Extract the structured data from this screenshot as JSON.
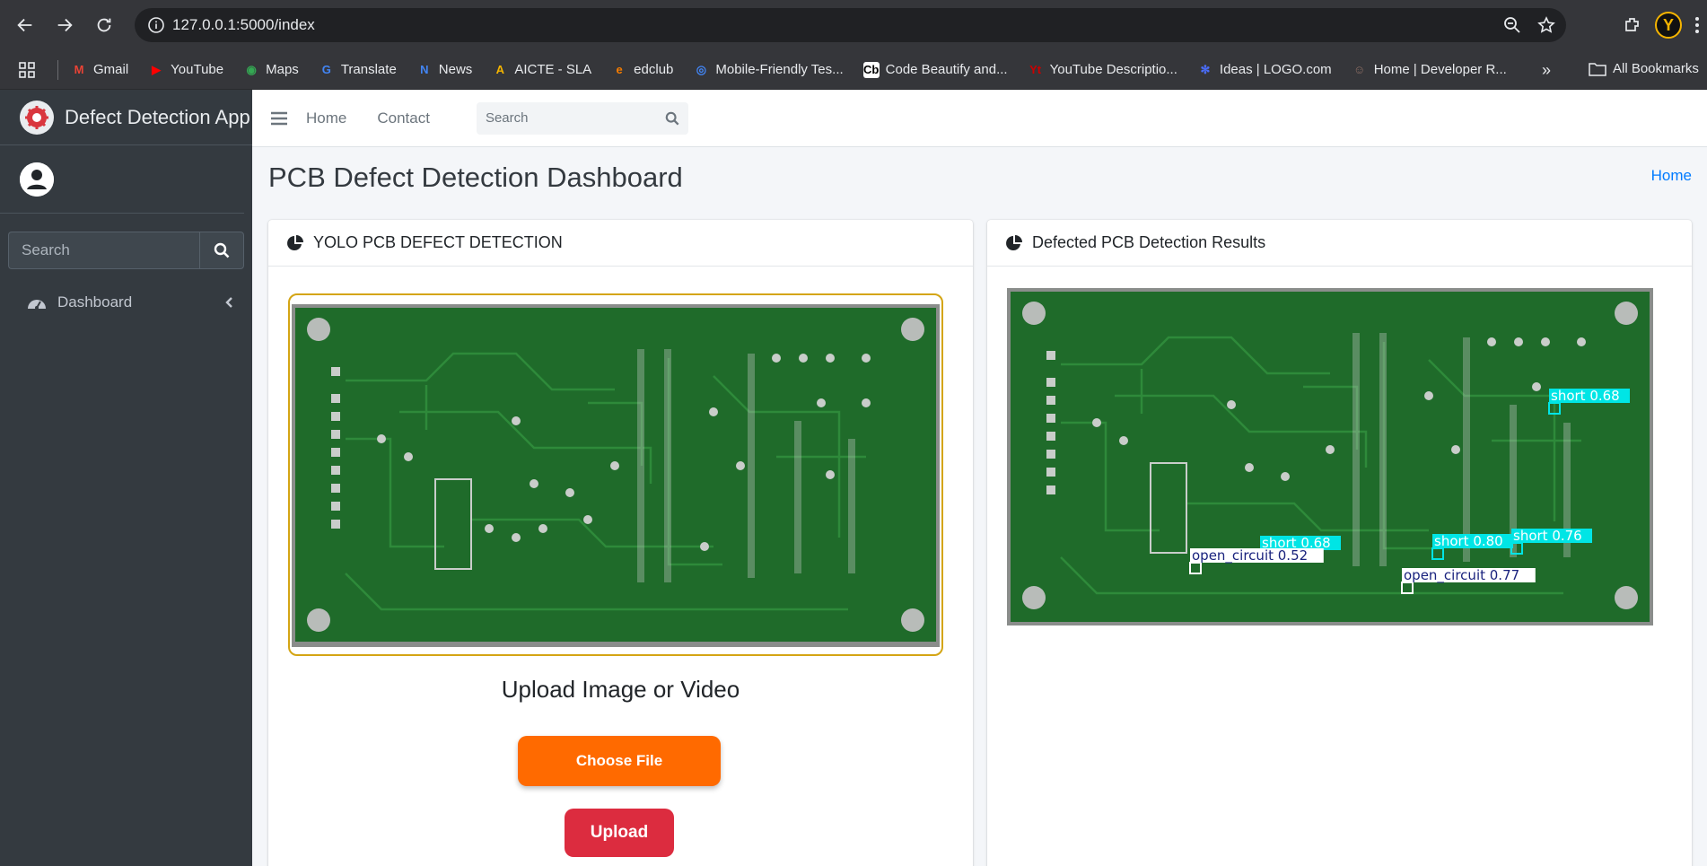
{
  "browser": {
    "url": "127.0.0.1:5000/index",
    "profile_initial": "Y",
    "bookmarks": [
      {
        "label": "Gmail",
        "color": "#ea4335",
        "glyph": "M"
      },
      {
        "label": "YouTube",
        "color": "#ff0000",
        "glyph": "▶"
      },
      {
        "label": "Maps",
        "color": "#34a853",
        "glyph": "◉"
      },
      {
        "label": "Translate",
        "color": "#4285f4",
        "glyph": "G"
      },
      {
        "label": "News",
        "color": "#4285f4",
        "glyph": "N"
      },
      {
        "label": "AICTE - SLA",
        "color": "#f4b400",
        "glyph": "A"
      },
      {
        "label": "edclub",
        "color": "#f57c00",
        "glyph": "e"
      },
      {
        "label": "Mobile-Friendly Tes...",
        "color": "#4285f4",
        "glyph": "◎"
      },
      {
        "label": "Code Beautify and...",
        "color": "#ffffff",
        "glyph": "Cb"
      },
      {
        "label": "YouTube Descriptio...",
        "color": "#cc0000",
        "glyph": "Yt"
      },
      {
        "label": "Ideas | LOGO.com",
        "color": "#4a6cf7",
        "glyph": "✻"
      },
      {
        "label": "Home | Developer R...",
        "color": "#8d6e63",
        "glyph": "☺"
      }
    ],
    "all_bookmarks": "All Bookmarks"
  },
  "app": {
    "brand": "Defect Detection App",
    "sidebar": {
      "search_placeholder": "Search",
      "nav": [
        {
          "label": "Dashboard"
        }
      ]
    },
    "topnav": {
      "links": [
        "Home",
        "Contact"
      ],
      "search_placeholder": "Search"
    },
    "page_title": "PCB Defect Detection Dashboard",
    "breadcrumb": "Home",
    "left_card": {
      "title": "YOLO PCB DEFECT DETECTION",
      "upload_title": "Upload Image or Video",
      "choose_label": "Choose File",
      "upload_label": "Upload"
    },
    "right_card": {
      "title": "Defected PCB Detection Results",
      "detections": [
        {
          "label": "short",
          "score": "0.68",
          "color": "#00e5e5"
        },
        {
          "label": "short",
          "score": "0.68",
          "color": "#00e5e5"
        },
        {
          "label": "short",
          "score": "0.80",
          "color": "#00e5e5"
        },
        {
          "label": "short",
          "score": "0.76",
          "color": "#00e5e5"
        },
        {
          "label": "open_circuit",
          "score": "0.52",
          "color": "#ffffff"
        },
        {
          "label": "open_circuit",
          "score": "0.77",
          "color": "#ffffff"
        }
      ]
    }
  },
  "colors": {
    "sidebar": "#343a40",
    "accent_link": "#007bff",
    "choose_btn": "#ff6a00",
    "upload_btn": "#dc2c3f",
    "pcb_green": "#1f6b2a"
  }
}
